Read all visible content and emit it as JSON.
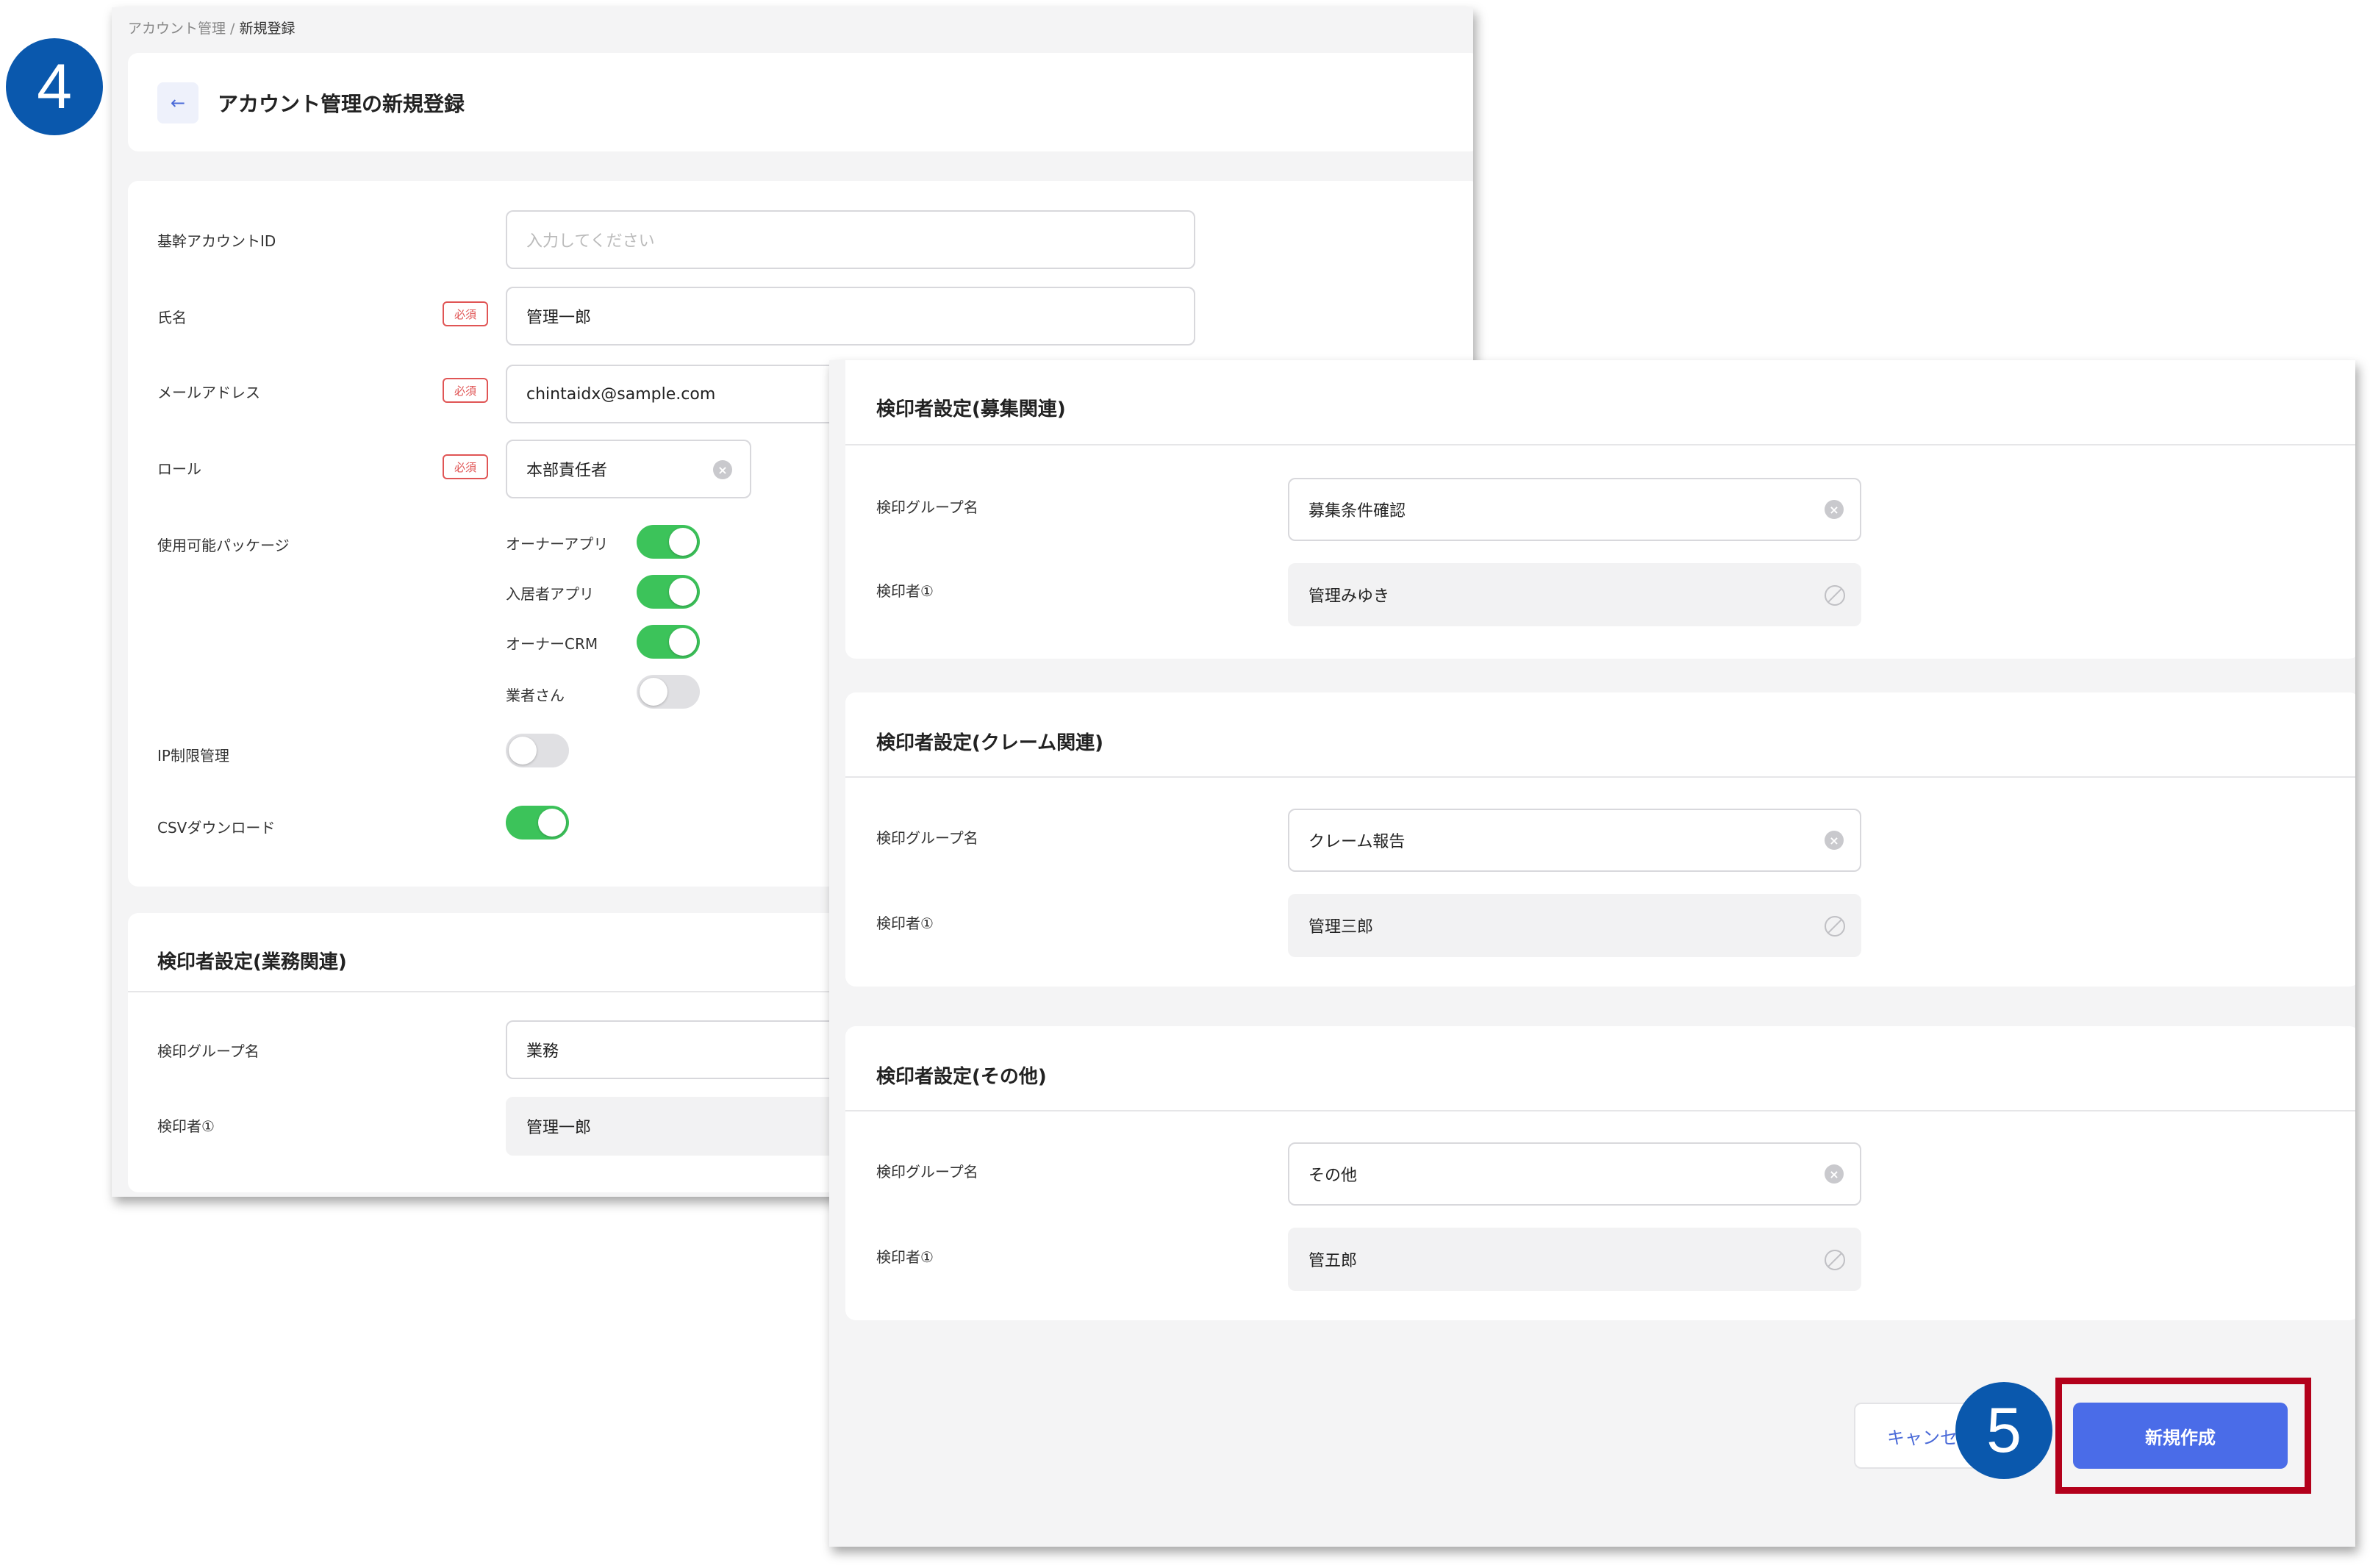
{
  "breadcrumb": {
    "parent": "アカウント管理",
    "separator": " / ",
    "current": "新規登録"
  },
  "header": {
    "title": "アカウント管理の新規登録",
    "back_icon": "←"
  },
  "form": {
    "required_badge": "必須",
    "core_account_id": {
      "label": "基幹アカウントID",
      "placeholder": "入力してください"
    },
    "name": {
      "label": "氏名",
      "value": "管理一郎"
    },
    "email": {
      "label": "メールアドレス",
      "value": "chintaidx@sample.com"
    },
    "role": {
      "label": "ロール",
      "value": "本部責任者"
    },
    "packages": {
      "label": "使用可能パッケージ",
      "items": [
        {
          "label": "オーナーアプリ",
          "on": true
        },
        {
          "label": "入居者アプリ",
          "on": true
        },
        {
          "label": "オーナーCRM",
          "on": true
        },
        {
          "label": "業者さん",
          "on": false
        }
      ]
    },
    "ip_limit": {
      "label": "IP制限管理",
      "on": false
    },
    "csv_download": {
      "label": "CSVダウンロード",
      "on": true
    }
  },
  "approver_business": {
    "title": "検印者設定(業務関連)",
    "group_label": "検印グループ名",
    "group_value": "業務",
    "approver_label": "検印者①",
    "approver_value": "管理一郎"
  },
  "approver_recruit": {
    "title": "検印者設定(募集関連)",
    "group_label": "検印グループ名",
    "group_value": "募集条件確認",
    "approver_label": "検印者①",
    "approver_value": "管理みゆき"
  },
  "approver_claim": {
    "title": "検印者設定(クレーム関連)",
    "group_label": "検印グループ名",
    "group_value": "クレーム報告",
    "approver_label": "検印者①",
    "approver_value": "管理三郎"
  },
  "approver_other": {
    "title": "検印者設定(その他)",
    "group_label": "検印グループ名",
    "group_value": "その他",
    "approver_label": "検印者①",
    "approver_value": "管五郎"
  },
  "actions": {
    "cancel_label": "キャンセル",
    "create_label": "新規作成"
  },
  "steps": {
    "step4": "4",
    "step5": "5"
  },
  "colors": {
    "primary": "#4a6ce8",
    "toggle_on": "#3cc35a",
    "required": "#e05555",
    "highlight": "#b3001b",
    "step_badge": "#0a58ad"
  }
}
